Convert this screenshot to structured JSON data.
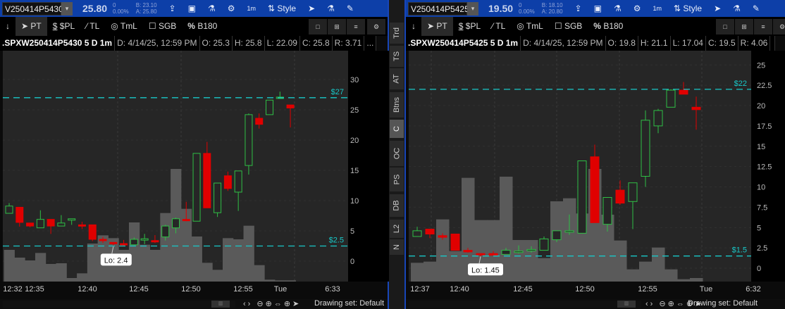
{
  "colors": {
    "up": "#2fbf45",
    "down": "#e00000",
    "priceline": "#18c8c8",
    "volume": "#5a5a5a",
    "bg": "#262626",
    "toolbar": "#0d3fa8"
  },
  "toolbar_labels": {
    "interval": "1m",
    "style": "Style"
  },
  "drawing_tools": [
    "PT",
    "$PL",
    "TL",
    "TmL",
    "SGB",
    "B180"
  ],
  "drawing_set": "Drawing set: Default",
  "side_tabs": [
    "Trd",
    "TS",
    "AT",
    "Btns",
    "C",
    "OC",
    "PS",
    "DB",
    "L2",
    "N"
  ],
  "active_side_tab": "C",
  "left": {
    "symbol": "V250414P5430",
    "last": "25.80",
    "change": "0",
    "change_pct": "0.00%",
    "bid": "B: 23.10",
    "ask": "A: 25.80",
    "info": {
      "title": ".SPXW250414P5430 5 D 1m",
      "date": "D: 4/14/25, 12:59 PM",
      "open": "O: 25.3",
      "high": "H: 25.8",
      "low": "L: 22.09",
      "close": "C: 25.8",
      "range": "R: 3.71",
      "more": "..."
    },
    "y_ticks": [
      0,
      5,
      10,
      15,
      20,
      25,
      30
    ],
    "x_ticks": [
      "12:32",
      "12:35",
      "12:40",
      "12:45",
      "12:50",
      "12:55",
      "Tue",
      "6:33"
    ],
    "price_lines": [
      {
        "value": 27,
        "label": "$27"
      },
      {
        "value": 2.5,
        "label": "$2.5"
      }
    ],
    "lo_label": "Lo: 2.4",
    "chart_data": {
      "type": "candlestick",
      "ylim": [
        0,
        33
      ],
      "ohlc": [
        [
          7.9,
          9.6,
          7.9,
          9.1
        ],
        [
          8.9,
          8.9,
          5.7,
          6.4
        ],
        [
          6.3,
          6.3,
          5.6,
          5.8
        ],
        [
          5.5,
          8.4,
          5.5,
          6.9
        ],
        [
          6.9,
          6.9,
          4.5,
          5.8
        ],
        [
          5.8,
          7.6,
          5.8,
          6.3
        ],
        [
          6.8,
          7.0,
          6.0,
          7.0
        ],
        [
          6.0,
          6.5,
          5.3,
          5.8
        ],
        [
          6.0,
          6.0,
          3.3,
          3.6
        ],
        [
          3.6,
          4.0,
          3.0,
          3.5
        ],
        [
          3.1,
          3.1,
          2.4,
          2.9
        ],
        [
          2.9,
          3.5,
          2.5,
          2.7
        ],
        [
          2.7,
          3.9,
          2.6,
          3.6
        ],
        [
          3.5,
          4.5,
          2.8,
          3.7
        ],
        [
          3.4,
          4.3,
          3.0,
          3.2
        ],
        [
          4.0,
          6.0,
          3.4,
          5.8
        ],
        [
          5.5,
          7.2,
          4.6,
          7.0
        ],
        [
          6.9,
          9.8,
          6.6,
          6.8
        ],
        [
          6.6,
          17.8,
          6.6,
          17.8
        ],
        [
          17.8,
          19.7,
          8.8,
          8.8
        ],
        [
          8.0,
          12.9,
          7.3,
          12.9
        ],
        [
          14.1,
          14.8,
          11.6,
          12.0
        ],
        [
          11.4,
          14.9,
          8.3,
          14.9
        ],
        [
          15.8,
          24.4,
          14.3,
          24.2
        ],
        [
          23.6,
          24.4,
          21.9,
          22.6
        ],
        [
          24.2,
          26.6,
          24.2,
          26.6
        ],
        [
          26.9,
          28.0,
          26.9,
          27.1
        ],
        [
          25.8,
          25.8,
          22.09,
          25.3
        ]
      ],
      "volume": [
        135,
        102,
        90,
        122,
        75,
        78,
        15,
        35,
        162,
        197,
        185,
        135,
        252,
        157,
        135,
        292,
        480,
        310,
        192,
        80,
        50,
        185,
        180,
        238,
        70,
        8,
        5,
        5
      ]
    }
  },
  "right": {
    "symbol": "V250414P5425",
    "last": "19.50",
    "change": "0",
    "change_pct": "0.00%",
    "bid": "B: 18.10",
    "ask": "A: 20.80",
    "info": {
      "title": ".SPXW250414P5425 5 D 1m",
      "date": "D: 4/14/25, 12:59 PM",
      "open": "O: 19.8",
      "high": "H: 21.1",
      "low": "L: 17.04",
      "close": "C: 19.5",
      "range": "R: 4.06"
    },
    "y_ticks": [
      0,
      2.5,
      5,
      7.5,
      10,
      12.5,
      15,
      17.5,
      20,
      22.5,
      25
    ],
    "x_ticks": [
      "12:37",
      "12:40",
      "12:45",
      "12:50",
      "12:55",
      "Tue",
      "6:32"
    ],
    "price_lines": [
      {
        "value": 22,
        "label": "$22"
      },
      {
        "value": 1.5,
        "label": "$1.5"
      }
    ],
    "lo_label": "Lo: 1.45",
    "chart_data": {
      "type": "candlestick",
      "ylim": [
        0,
        27
      ],
      "ohlc": [
        [
          3.9,
          5.1,
          3.9,
          4.6
        ],
        [
          4.8,
          4.8,
          3.7,
          4.2
        ],
        [
          4.0,
          4.3,
          3.5,
          3.8
        ],
        [
          4.2,
          4.2,
          2.2,
          2.2
        ],
        [
          2.2,
          2.5,
          1.9,
          2.0
        ],
        [
          1.8,
          1.8,
          1.45,
          1.7
        ],
        [
          1.8,
          2.1,
          1.6,
          1.6
        ],
        [
          1.7,
          2.5,
          1.7,
          2.2
        ],
        [
          2.0,
          2.8,
          1.8,
          2.1
        ],
        [
          2.2,
          2.7,
          1.9,
          2.3
        ],
        [
          2.2,
          3.9,
          2.2,
          3.6
        ],
        [
          3.5,
          4.6,
          3.2,
          4.6
        ],
        [
          4.5,
          6.6,
          4.1,
          4.6
        ],
        [
          4.3,
          13.2,
          4.3,
          13.2
        ],
        [
          13.7,
          15.2,
          5.6,
          5.6
        ],
        [
          5.4,
          8.7,
          4.5,
          8.7
        ],
        [
          9.6,
          10.8,
          7.8,
          8.0
        ],
        [
          8.2,
          10.5,
          4.8,
          10.5
        ],
        [
          11.3,
          19.4,
          10.0,
          18.2
        ],
        [
          17.5,
          19.6,
          16.6,
          19.4
        ],
        [
          19.8,
          22.0,
          19.8,
          21.9
        ],
        [
          21.9,
          22.9,
          21.4,
          21.4
        ],
        [
          19.8,
          21.1,
          17.04,
          19.5
        ]
      ],
      "volume": [
        80,
        85,
        265,
        130,
        442,
        262,
        262,
        447,
        177,
        177,
        100,
        342,
        355,
        290,
        480,
        285,
        175,
        52,
        85,
        145,
        52,
        10,
        15
      ]
    }
  }
}
